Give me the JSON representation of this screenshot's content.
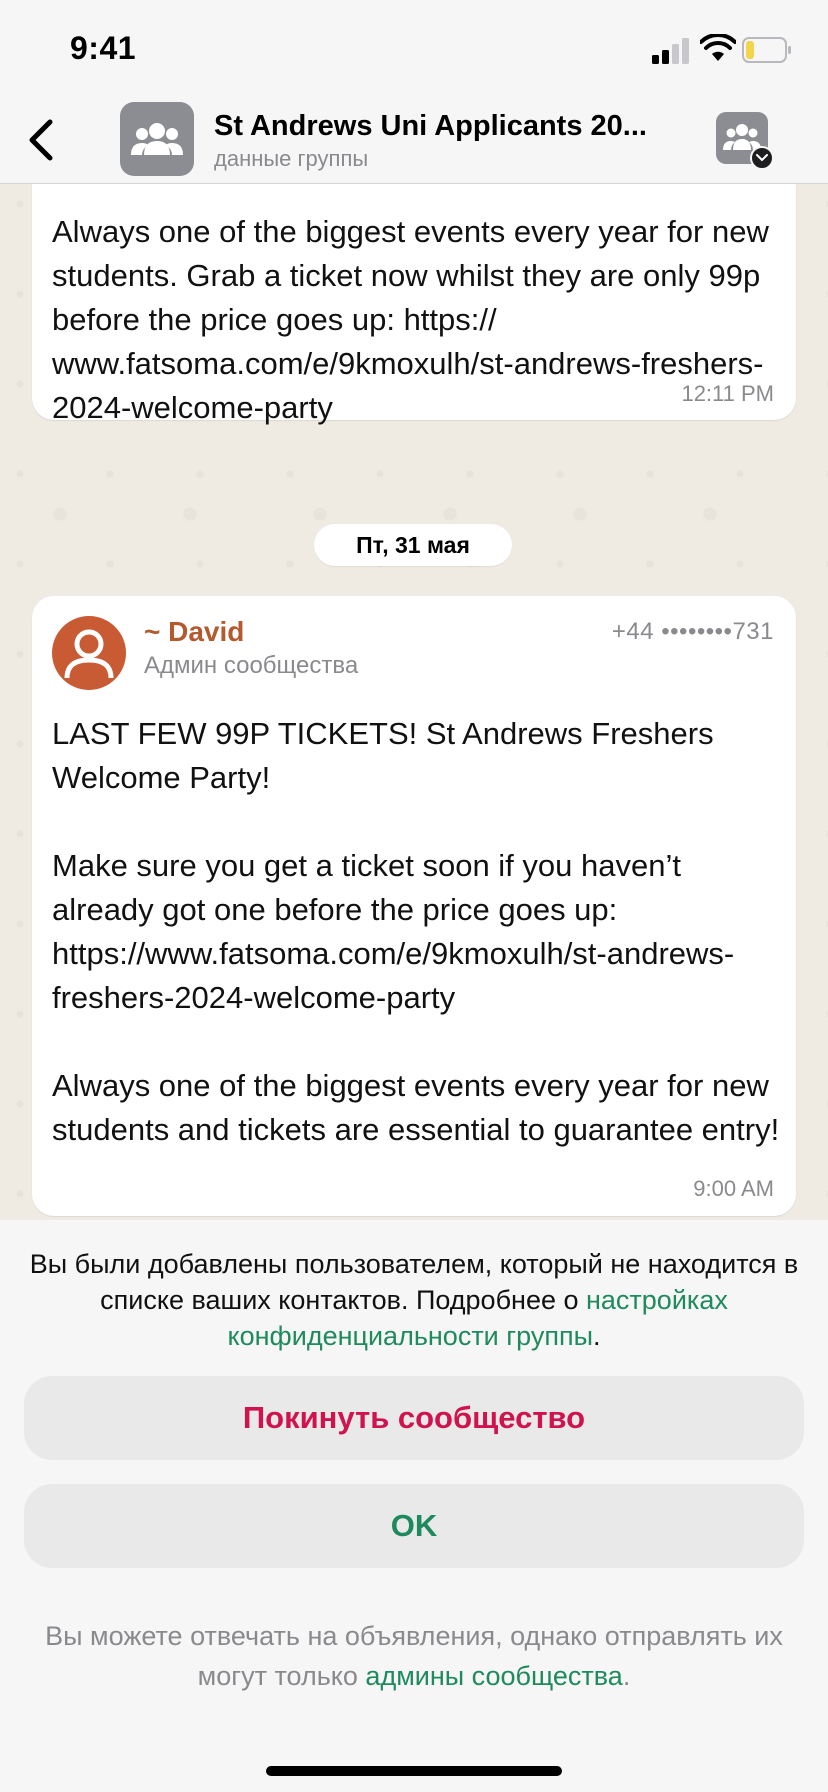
{
  "status_bar": {
    "time": "9:41"
  },
  "header": {
    "title": "St Andrews Uni Applicants 20...",
    "subtitle": "данные группы"
  },
  "messages": [
    {
      "text": "Always one of the biggest events every year for new students. Grab a ticket now whilst they are only 99p before the price goes up: https://​www.fatsoma.com/e/9kmoxulh/st-andrews-freshers-2024-welcome-party",
      "time": "12:11 PM"
    },
    {
      "sender_name": "~ David",
      "sender_phone": "+44 ••••••••731",
      "sender_role": "Админ сообщества",
      "text": "LAST FEW 99P TICKETS! St Andrews Freshers Welcome Party!\n\nMake sure you get a ticket soon if you haven’t already got one before the price goes up: https://www.fatsoma.com/e/9kmoxulh/st-andrews-freshers-2024-welcome-party\n\nAlways one of the biggest events every year for new students and tickets are essential to guarantee entry!",
      "time": "9:00 AM"
    }
  ],
  "date_separator": "Пт, 31 мая",
  "bottom_sheet": {
    "notice_text": "Вы были добавлены пользователем, который не находится в списке ваших контактов. Подробнее о ",
    "notice_link": "настройках конфиденциальности группы",
    "notice_end": ".",
    "leave_label": "Покинуть сообщество",
    "ok_label": "OK",
    "footer_text": "Вы можете отвечать на объявления, однако отправлять их могут только ",
    "footer_link": "админы сообщества",
    "footer_end": "."
  },
  "colors": {
    "accent_green": "#1f8a5e",
    "destructive_red": "#d0134e",
    "sender_name": "#b35a2f",
    "sender_avatar": "#c85a34",
    "chat_background": "#efeae2"
  },
  "icons": {
    "back": "chevron-left-icon",
    "group": "group-icon",
    "community": "community-icon",
    "signal": "signal-icon",
    "wifi": "wifi-icon",
    "battery": "battery-icon",
    "avatar": "person-icon"
  }
}
